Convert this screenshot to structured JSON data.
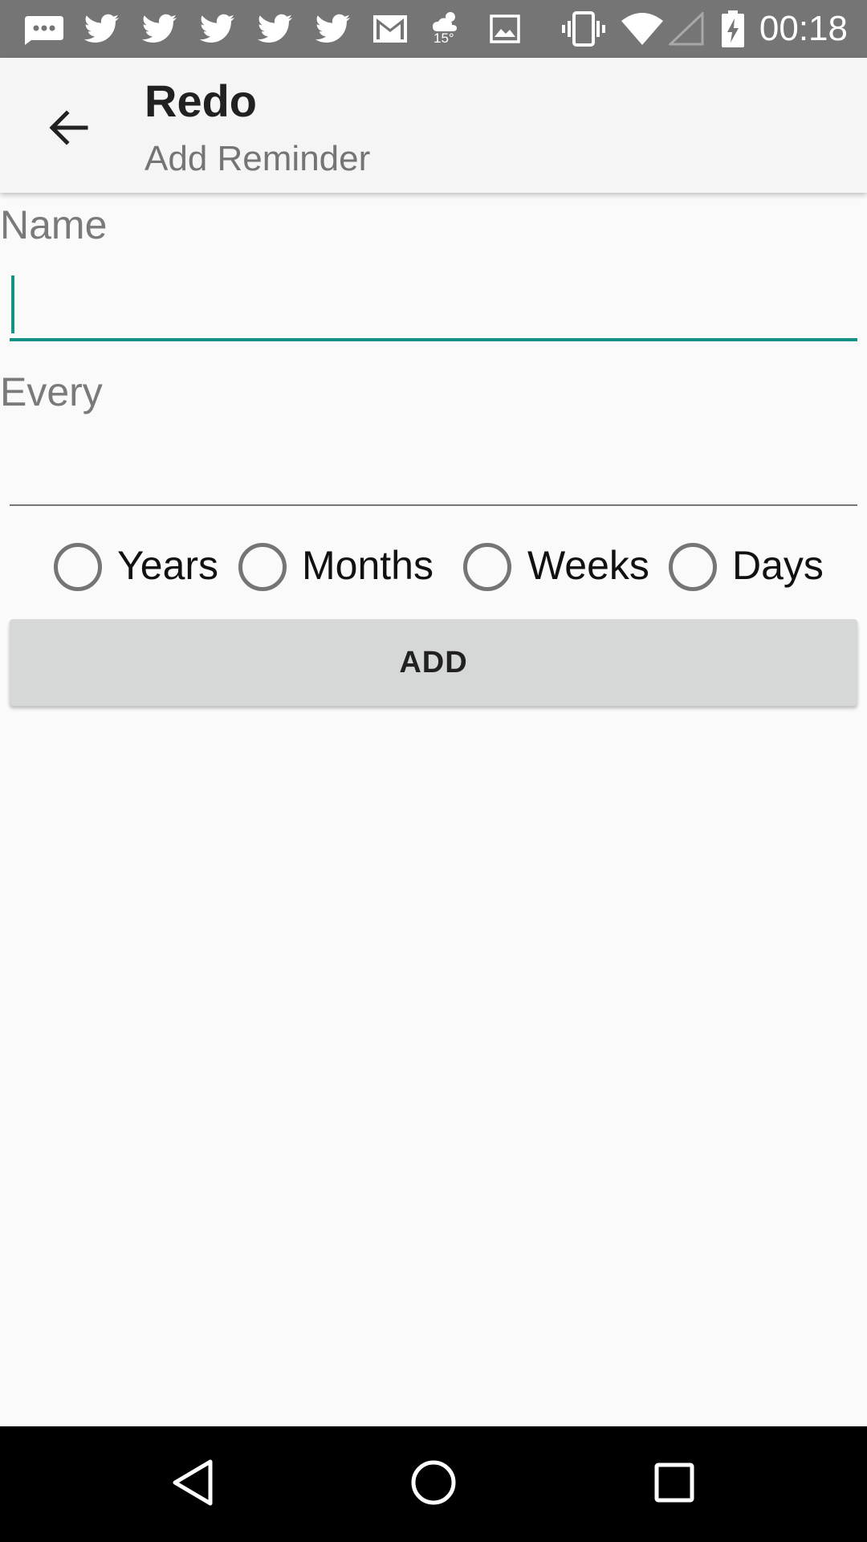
{
  "status_bar": {
    "time": "00:18",
    "temperature": "15°",
    "icons": [
      "messages-icon",
      "twitter-icon",
      "twitter-icon",
      "twitter-icon",
      "twitter-icon",
      "twitter-icon",
      "gmail-icon",
      "weather-icon",
      "gallery-icon",
      "vibrate-icon",
      "wifi-icon",
      "signal-icon",
      "battery-charging-icon"
    ]
  },
  "app_bar": {
    "title": "Redo",
    "subtitle": "Add Reminder"
  },
  "form": {
    "name_label": "Name",
    "name_value": "",
    "every_label": "Every",
    "every_value": "",
    "units": [
      {
        "label": "Years",
        "checked": false
      },
      {
        "label": "Months",
        "checked": false
      },
      {
        "label": "Weeks",
        "checked": false
      },
      {
        "label": "Days",
        "checked": false
      }
    ],
    "add_label": "ADD"
  },
  "colors": {
    "accent": "#159186",
    "status_bar": "#757575",
    "app_bar": "#f5f5f5",
    "button": "#d6d7d7"
  }
}
